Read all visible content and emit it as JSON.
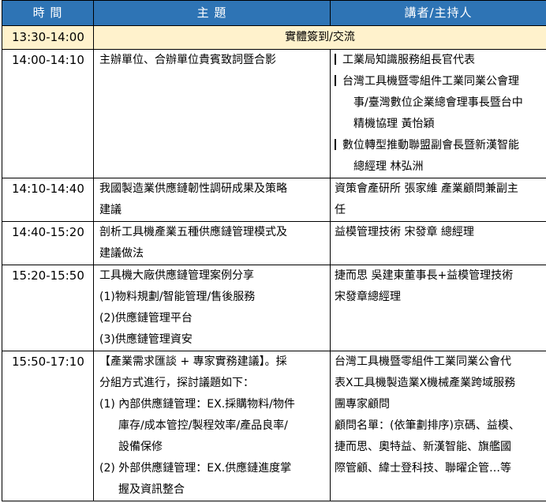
{
  "header": {
    "time": "時 間",
    "topic": "主 題",
    "speaker": "講者/主持人"
  },
  "registration": {
    "time": "13:30-14:00",
    "text": "實體簽到/交流"
  },
  "rows": [
    {
      "time": "14:00-14:10",
      "topic": [
        "主辦單位、合辦單位貴賓致詞暨合影"
      ],
      "speaker": {
        "bullets": [
          [
            "工業局知識服務組長官代表"
          ],
          [
            "台灣工具機暨零組件工業同業公會理",
            "事/臺灣數位企業總會理事長暨台中",
            "精機協理 黃怡穎"
          ],
          [
            "數位轉型推動聯盟副會長暨新漢智能",
            "總經理 林弘洲"
          ]
        ]
      }
    },
    {
      "time": "14:10-14:40",
      "topic": [
        "我國製造業供應鏈韌性調研成果及策略",
        "建議"
      ],
      "speaker": {
        "lines": [
          "資策會產研所 張家維 產業顧問兼副主",
          "任"
        ]
      }
    },
    {
      "time": "14:40-15:20",
      "topic": [
        "剖析工具機產業五種供應鏈管理模式及",
        "建議做法"
      ],
      "speaker": {
        "lines": [
          "益模管理技術 宋發章 總經理"
        ]
      }
    },
    {
      "time": "15:20-15:50",
      "topic": [
        "工具機大廠供應鏈管理案例分享",
        "(1)物料規劃/智能管理/售後服務",
        "(2)供應鏈管理平台",
        "(3)供應鏈管理資安"
      ],
      "speaker": {
        "lines": [
          "捷而思 吳建東董事長+益模管理技術",
          "宋發章總經理"
        ]
      }
    },
    {
      "time": "15:50-17:10",
      "topic_intro": [
        "【產業需求匯談 + 專家實務建議】。採",
        "分組方式進行，探討議題如下："
      ],
      "topic_items": [
        {
          "num": "(1)",
          "lines": [
            "內部供應鏈管理：EX.採購物料/物件",
            "庫存/成本管控/製程效率/產品良率/",
            "設備保修"
          ]
        },
        {
          "num": "(2)",
          "lines": [
            "外部供應鏈管理：EX.供應鏈進度掌",
            "握及資訊整合"
          ]
        }
      ],
      "speaker": {
        "lines": [
          "台灣工具機暨零組件工業同業公會代",
          "表X工具機製造業X機械產業跨域服務",
          "團專家顧問",
          "顧問名單：(依筆劃排序)京碼、益模、",
          "捷而思、奧特益、新漢智能、旗艦國",
          "際管顧、緯士登科技、聯曜企管…等"
        ]
      }
    }
  ]
}
